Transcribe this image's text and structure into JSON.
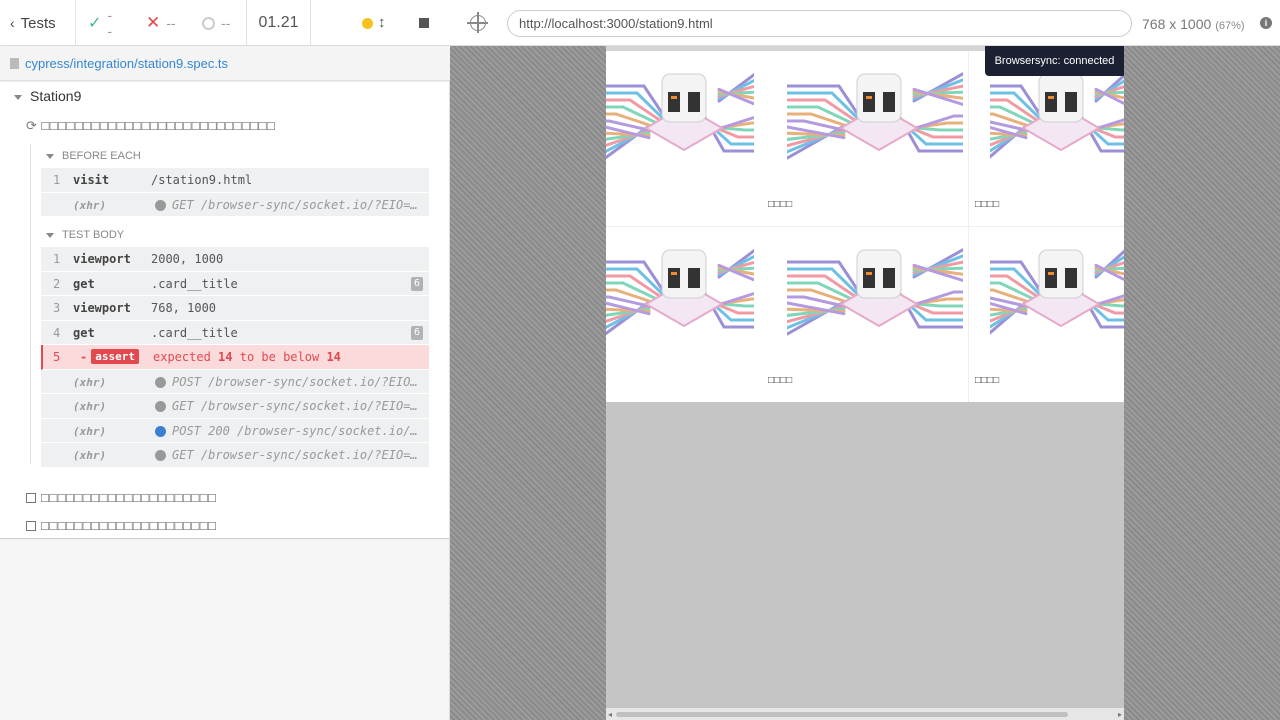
{
  "reporter": {
    "tests_label": "Tests",
    "passed": "--",
    "failed": "--",
    "pending": "--",
    "duration": "01.21",
    "spec_file": "cypress/integration/station9.spec.ts",
    "suite": "Station9",
    "test_title": "□□□□□□□□□□□□□□□□□□□□□□□□□□□□",
    "before_each_label": "BEFORE EACH",
    "before_each": [
      {
        "num": "1",
        "name": "visit",
        "msg": "/station9.html"
      },
      {
        "num": "",
        "name": "(xhr)",
        "msg": "GET /browser-sync/socket.io/?EIO=…",
        "xhr": true
      }
    ],
    "test_body_label": "TEST BODY",
    "test_body": [
      {
        "num": "1",
        "name": "viewport",
        "msg": "2000, 1000"
      },
      {
        "num": "2",
        "name": "get",
        "msg": ".card__title",
        "badge": "6"
      },
      {
        "num": "3",
        "name": "viewport",
        "msg": "768, 1000"
      },
      {
        "num": "4",
        "name": "get",
        "msg": ".card__title",
        "badge": "6"
      }
    ],
    "failed_assert": {
      "num": "5",
      "dash": "-",
      "tag": "assert",
      "pre": "expected",
      "a": "14",
      "mid": "to be below",
      "b": "14"
    },
    "xhr_after": [
      {
        "msg": "POST /browser-sync/socket.io/?EIO…",
        "dot": "grey"
      },
      {
        "msg": "GET /browser-sync/socket.io/?EIO=…",
        "dot": "grey"
      },
      {
        "msg": "POST 200 /browser-sync/socket.io/…",
        "dot": "blue"
      },
      {
        "msg": "GET /browser-sync/socket.io/?EIO=…",
        "dot": "grey"
      }
    ],
    "xhr_label": "(xhr)",
    "pending_tests": [
      "□□□□□□□□□□□□□□□□□□□□□",
      "□□□□□□□□□□□□□□□□□□□□□"
    ]
  },
  "aut": {
    "url": "http://localhost:3000/station9.html",
    "viewport": "768 x 1000",
    "scale": "(67%)",
    "toast": "Browsersync: connected",
    "cards": [
      {
        "title": "□□□□"
      },
      {
        "title": "□□□□"
      },
      {
        "title": "□□□□"
      },
      {
        "title": "□□□□"
      },
      {
        "title": "□□□□"
      },
      {
        "title": "□□□□"
      }
    ]
  },
  "colors": {
    "pass": "#3cba7e",
    "fail": "#e2494e",
    "link": "#3386d4",
    "running": "#f8c11e"
  }
}
